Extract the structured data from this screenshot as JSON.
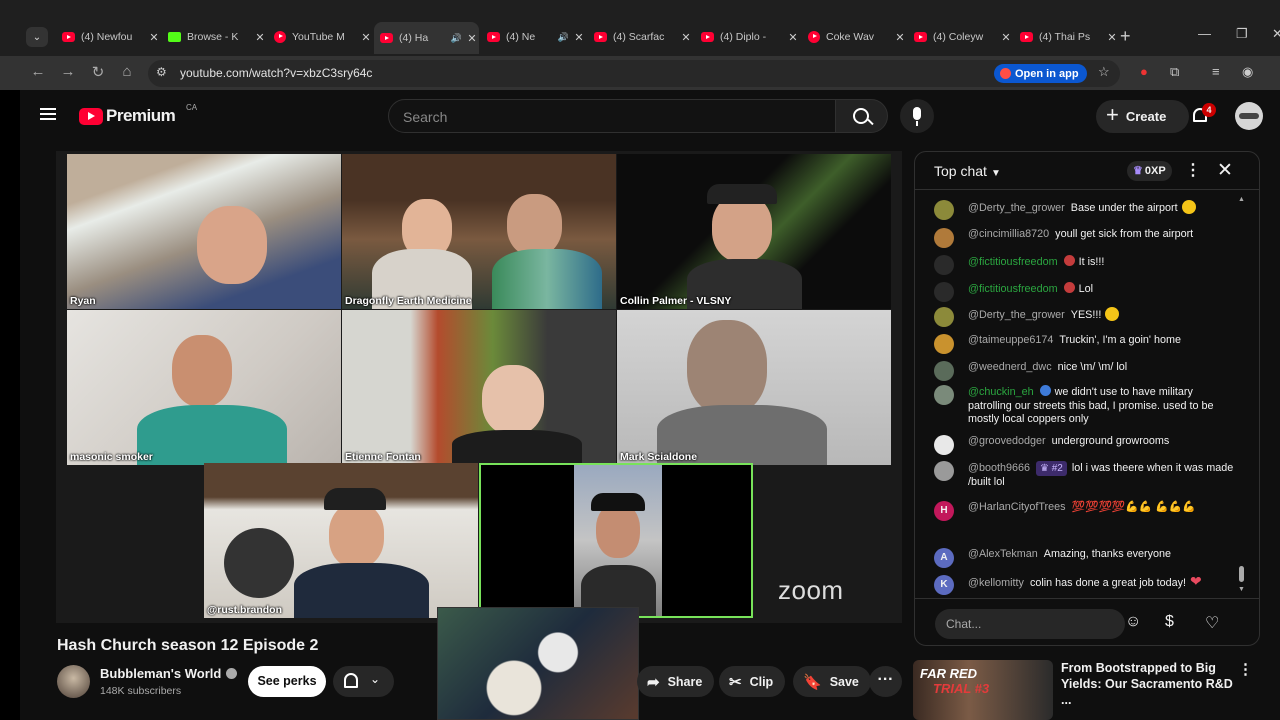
{
  "browser": {
    "tabs": [
      {
        "label": "(4) Newfou",
        "icon": "youtube"
      },
      {
        "label": "Browse - K",
        "icon": "kick"
      },
      {
        "label": "YouTube M",
        "icon": "youtube-music"
      },
      {
        "label": "(4) Ha",
        "icon": "youtube",
        "active": true,
        "audio": true
      },
      {
        "label": "(4) Ne",
        "icon": "youtube",
        "audio": true
      },
      {
        "label": "(4) Scarfac",
        "icon": "youtube"
      },
      {
        "label": "(4) Diplo -",
        "icon": "youtube"
      },
      {
        "label": "Coke Wav",
        "icon": "youtube-music"
      },
      {
        "label": "(4) Coleyw",
        "icon": "youtube"
      },
      {
        "label": "(4) Thai Ps",
        "icon": "youtube"
      }
    ],
    "url": "youtube.com/watch?v=xbzC3sry64c",
    "open_in_app": "Open in app"
  },
  "youtube": {
    "logo": "Premium",
    "country": "CA",
    "search_placeholder": "Search",
    "create_label": "Create",
    "notification_count": "4"
  },
  "video": {
    "participants": [
      {
        "name": "Ryan"
      },
      {
        "name": "Dragonfly Earth Medicine"
      },
      {
        "name": "Collin Palmer - VLSNY"
      },
      {
        "name": "masonic smoker"
      },
      {
        "name": "Etienne Fontan"
      },
      {
        "name": "Mark Scialdone"
      },
      {
        "name": "@rust.brandon"
      },
      {
        "name": ""
      }
    ],
    "watermark": "zoom",
    "title": "Hash Church season 12 Episode 2",
    "channel": "Bubbleman's World",
    "subscribers": "148K subscribers",
    "see_perks": "See perks",
    "actions": {
      "share": "Share",
      "clip": "Clip",
      "save": "Save"
    }
  },
  "chat": {
    "title": "Top chat",
    "xp": "0XP",
    "input_placeholder": "Chat...",
    "messages": [
      {
        "author": "@Derty_the_grower",
        "text": "Base under the airport",
        "emoji": true
      },
      {
        "author": "@cincimillia8720",
        "text": "youll get sick from the airport"
      },
      {
        "author": "@fictitiousfreedom",
        "text": "It is!!!",
        "green": true
      },
      {
        "author": "@fictitiousfreedom",
        "text": "Lol",
        "green": true
      },
      {
        "author": "@Derty_the_grower",
        "text": "YES!!!",
        "emoji": true
      },
      {
        "author": "@taimeuppe6174",
        "text": "Truckin', I'm a goin' home"
      },
      {
        "author": "@weednerd_dwc",
        "text": "nice \\m/ \\m/ lol"
      },
      {
        "author": "@chuckin_eh",
        "text": "we didn't use to have military patrolling our streets this bad, I promise. used to be mostly local coppers only",
        "green": true
      },
      {
        "author": "@groovedodger",
        "text": "underground growrooms"
      },
      {
        "author": "@booth9666",
        "badge": "#2",
        "text": "lol i was theere when it was made /built lol"
      },
      {
        "author": "@HarlanCityofTrees",
        "text": "💯💯💯💯💪💪 💪💪💪"
      },
      {
        "author": "@AlexTekman",
        "text": "Amazing, thanks everyone",
        "initial": "A"
      },
      {
        "author": "@kellomitty",
        "text": "colin has done a great job today!",
        "initial": "K"
      }
    ]
  },
  "recommendation": {
    "thumb_line1": "FAR RED",
    "thumb_line2": "TRIAL #3",
    "title": "From Bootstrapped to Big Yields: Our Sacramento R&D ..."
  }
}
